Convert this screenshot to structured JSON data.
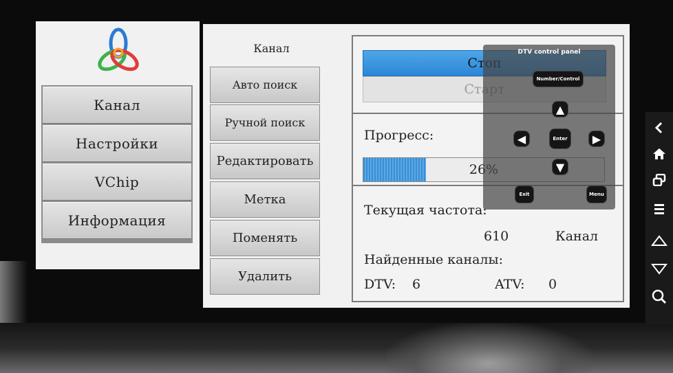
{
  "left_menu": {
    "items": [
      {
        "label": "Канал"
      },
      {
        "label": "Настройки"
      },
      {
        "label": "VChip"
      },
      {
        "label": "Информация"
      }
    ]
  },
  "channel_panel": {
    "title": "Канал",
    "buttons": [
      {
        "label": "Авто поиск"
      },
      {
        "label": "Ручной поиск"
      },
      {
        "label": "Редактировать"
      },
      {
        "label": "Метка"
      },
      {
        "label": "Поменять"
      },
      {
        "label": "Удалить"
      }
    ]
  },
  "scan": {
    "stop_label": "Стоп",
    "start_label": "Старт",
    "progress_label": "Прогресс:",
    "progress_value": 26,
    "progress_text": "26%",
    "freq_label": "Текущая частота:",
    "freq_value": "610",
    "freq_unit": "Канал",
    "found_label": "Найденные каналы:",
    "dtv_label": "DTV:",
    "dtv_value": "6",
    "atv_label": "ATV:",
    "atv_value": "0"
  },
  "dtv_panel": {
    "title": "DTV control panel",
    "number_control": "Number/Control",
    "enter": "Enter",
    "exit": "Exit",
    "menu": "Menu"
  },
  "side_toolbar": {
    "icons": [
      "back-icon",
      "home-icon",
      "windows-icon",
      "menu-icon",
      "up-triangle-icon",
      "down-triangle-icon",
      "search-icon"
    ]
  },
  "colors": {
    "accent_blue": "#2a86d6",
    "panel_bg": "#f1f1f1"
  }
}
